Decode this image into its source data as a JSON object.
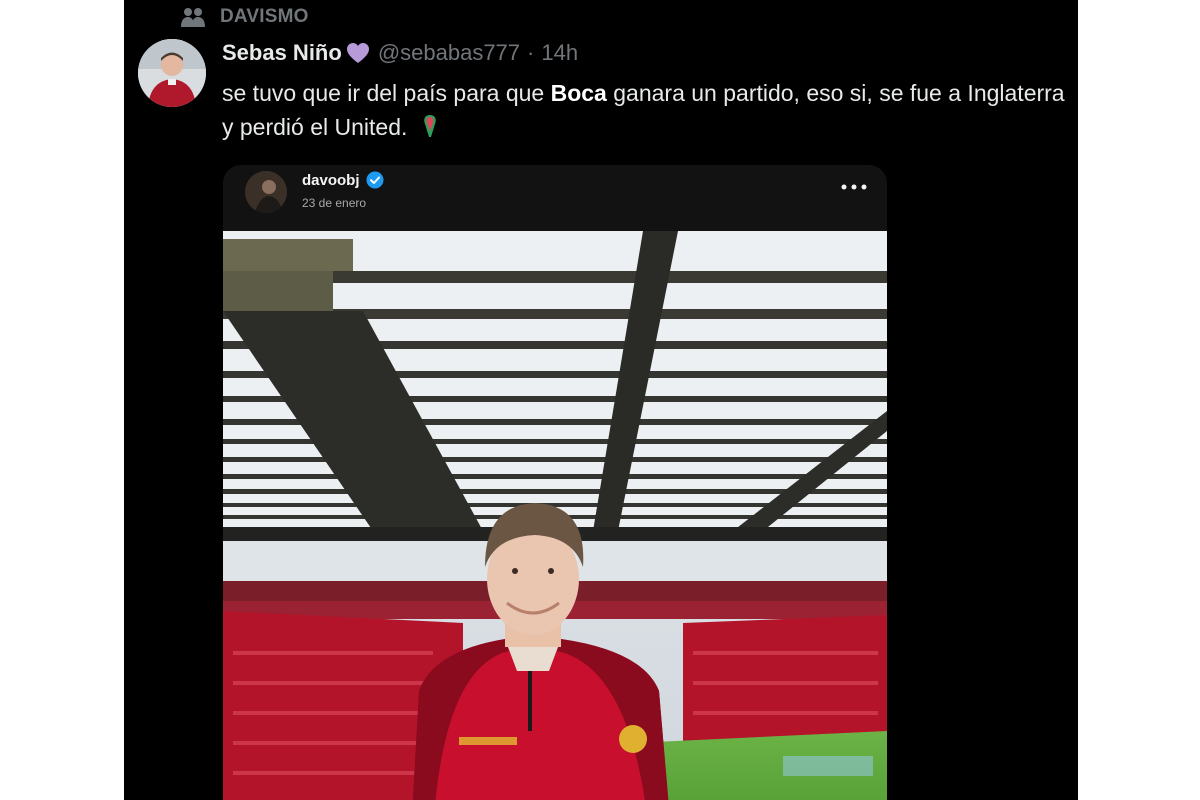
{
  "social_context": {
    "icon": "people-icon",
    "label": "DAVISMO"
  },
  "tweet": {
    "avatar_icon": "user-avatar",
    "display_name": "Sebas Niño",
    "name_emoji": "purple-heart-icon",
    "handle": "@sebabas777",
    "separator": "·",
    "time": "14h",
    "text_before_bold": "se tuvo que ir del país para que ",
    "text_bold": "Boca",
    "text_after_bold": " ganara un partido, eso si, se fue a Inglaterra y perdió el United.",
    "text_emoji": "pin-emoji-icon"
  },
  "embedded_post": {
    "username": "davoobj",
    "verified_icon": "verified-badge-icon",
    "date": "23 de enero",
    "more_icon": "more-options-icon",
    "photo_subject": "stadium-photo"
  },
  "colors": {
    "background": "#000000",
    "primary_text": "#e7e9ea",
    "secondary_text": "#71767b",
    "verified_blue": "#1d9bf0",
    "jersey_red": "#c8102e",
    "seat_red": "#b3142a",
    "pitch_green": "#5fa83a"
  }
}
